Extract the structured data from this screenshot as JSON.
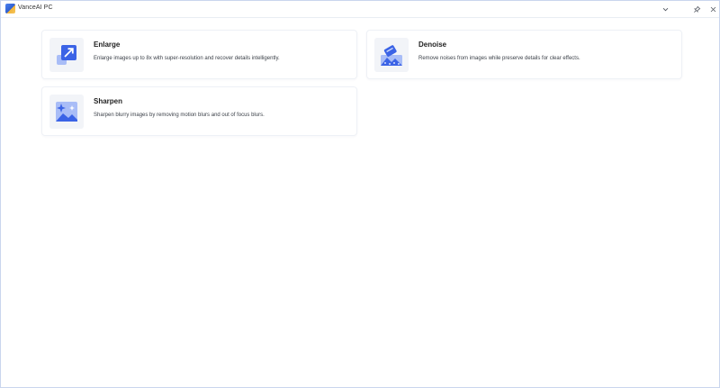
{
  "window": {
    "title": "VanceAI PC"
  },
  "titlebar": {
    "controls": [
      {
        "name": "collapse",
        "icon": "chevron-down-icon"
      },
      {
        "name": "pin",
        "icon": "pin-icon"
      },
      {
        "name": "close",
        "icon": "close-icon"
      }
    ]
  },
  "tools": [
    {
      "title": "Enlarge",
      "description": "Enlarge images up to 8x with super-resolution and recover details intelligently.",
      "icon": "enlarge-icon"
    },
    {
      "title": "Denoise",
      "description": "Remove noises from images while preserve details for clear effects.",
      "icon": "denoise-icon"
    },
    {
      "title": "Sharpen",
      "description": "Sharpen blurry images by removing motion blurs and out of focus blurs.",
      "icon": "sharpen-icon"
    }
  ],
  "colors": {
    "accent": "#3b63e6",
    "accent_light": "#a9bdf7",
    "card_border": "#eef1f6",
    "thumb_bg": "#f2f4f8"
  }
}
